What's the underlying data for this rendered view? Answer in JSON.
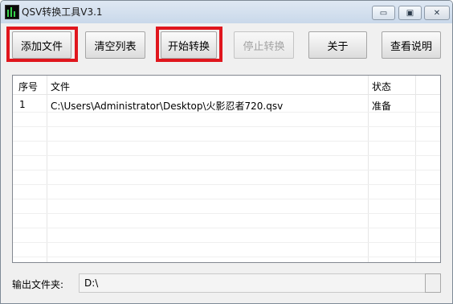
{
  "window": {
    "title": "QSV转换工具V3.1"
  },
  "window_controls": {
    "minimize": "▭",
    "restore": "▣",
    "close": "✕"
  },
  "toolbar": {
    "add_file": "添加文件",
    "clear_list": "清空列表",
    "start_convert": "开始转换",
    "stop_convert": "停止转换",
    "about": "关于",
    "view_help": "查看说明"
  },
  "file_list": {
    "columns": [
      "序号",
      "文件",
      "状态"
    ],
    "rows": [
      {
        "index": "1",
        "file": "C:\\Users\\Administrator\\Desktop\\火影忍者720.qsv",
        "status": "准备"
      }
    ]
  },
  "output": {
    "label": "输出文件夹:",
    "value": "D:\\"
  },
  "highlights": {
    "color": "#e0161d"
  }
}
